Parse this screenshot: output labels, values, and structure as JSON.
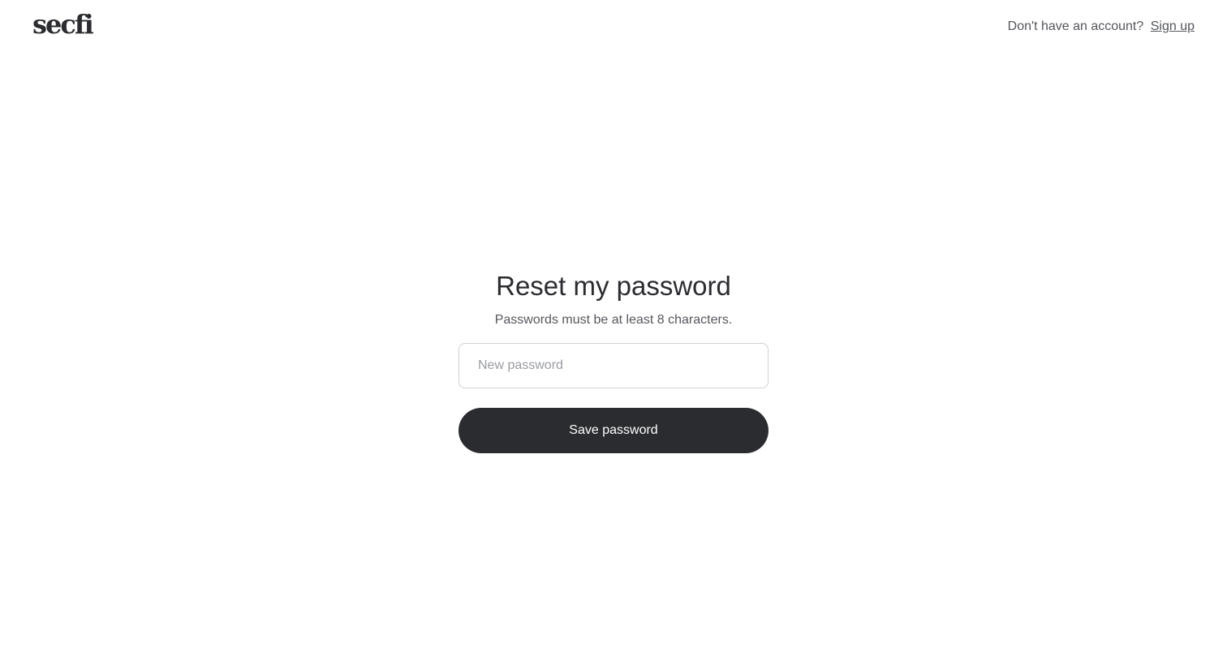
{
  "header": {
    "logo_text": "secfi",
    "signup_prompt": "Don't have an account?",
    "signup_link": "Sign up"
  },
  "form": {
    "title": "Reset my password",
    "subtitle": "Passwords must be at least 8 characters.",
    "password_placeholder": "New password",
    "password_value": "",
    "save_label": "Save password"
  },
  "colors": {
    "primary_button": "#2b2c30",
    "text_muted": "#55575d",
    "input_border": "#cfd0d3"
  }
}
